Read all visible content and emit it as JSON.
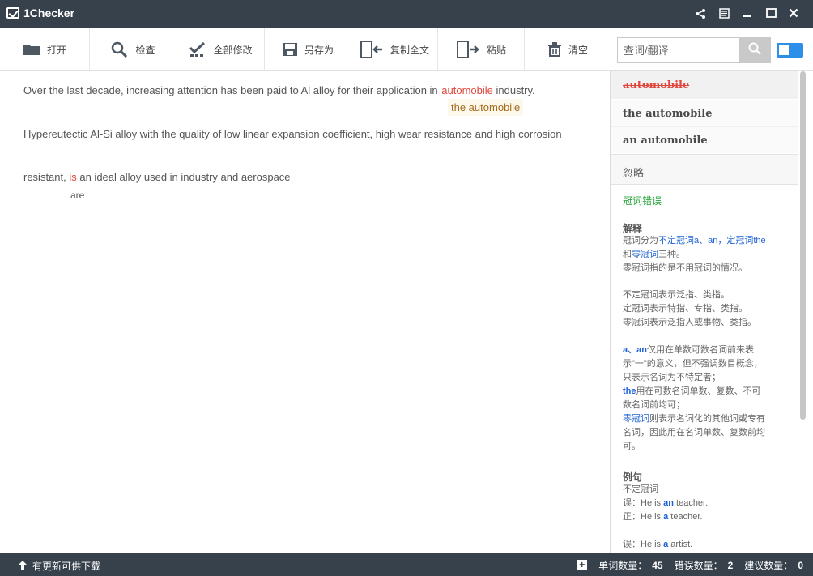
{
  "app": {
    "title": "1Checker"
  },
  "toolbar": {
    "open": "打开",
    "check": "检查",
    "fix_all": "全部修改",
    "save_as": "另存为",
    "copy_all": "复制全文",
    "paste": "粘贴",
    "clear": "清空"
  },
  "search": {
    "placeholder": "查词/翻译"
  },
  "editor": {
    "line1_before": "Over the last decade, increasing attention has been paid to Al alloy for their application in ",
    "line1_error": "automobile",
    "line1_after": " industry.",
    "line1_suggestion": "the automobile",
    "line2": "Hypereutectic Al-Si alloy with the quality of low linear expansion coefficient, high wear resistance and high corrosion",
    "line3_before": "resistant, ",
    "line3_error": "is",
    "line3_after": " an ideal alloy used in industry and aerospace",
    "line3_suggestion": "are"
  },
  "panel": {
    "error_word": "automobile",
    "option1": "the automobile",
    "option2": "an automobile",
    "ignore": "忽略",
    "category": "冠词错误",
    "explain_title": "解释",
    "explain": {
      "l1_a": "冠词分为",
      "l1_b": "不定冠词a、an",
      "l1_c": "，",
      "l1_d": "定冠词the",
      "l2_a": "和",
      "l2_b": "零冠词",
      "l2_c": "三种。",
      "l3": "零冠词指的是不用冠词的情况。",
      "l4": "不定冠词表示泛指、类指。",
      "l5": "定冠词表示特指、专指、类指。",
      "l6": "零冠词表示泛指人或事物、类指。",
      "l7_a": "a、an",
      "l7_b": "仅用在单数可数名词前来表",
      "l8": "示\"一\"的意义，但不强调数目概念，",
      "l9": "只表示名词为不特定者；",
      "l10_a": "the",
      "l10_b": "用在可数名词单数、复数、不可",
      "l11": "数名词前均可；",
      "l12_a": "零冠词",
      "l12_b": "则表示名词化的其他词或专有",
      "l13": "名词，因此用在名词单数、复数前均",
      "l14": "可。"
    },
    "example_title": "例句",
    "example_sub": "不定冠词",
    "ex1_a": "误：He is ",
    "ex1_b": "an",
    "ex1_c": " teacher.",
    "ex2_a": "正：He is ",
    "ex2_b": "a",
    "ex2_c": " teacher.",
    "ex3_a": "误：He is ",
    "ex3_b": "a",
    "ex3_c": " artist."
  },
  "status": {
    "update": "有更新可供下载",
    "word_count_label": "单词数量：",
    "word_count": "45",
    "error_count_label": "错误数量：",
    "error_count": "2",
    "suggestion_count_label": "建议数量：",
    "suggestion_count": "0"
  },
  "colors": {
    "accent": "#2e8fe8",
    "error": "#e0463c",
    "chrome": "#37414c",
    "category": "#2aa53e"
  }
}
